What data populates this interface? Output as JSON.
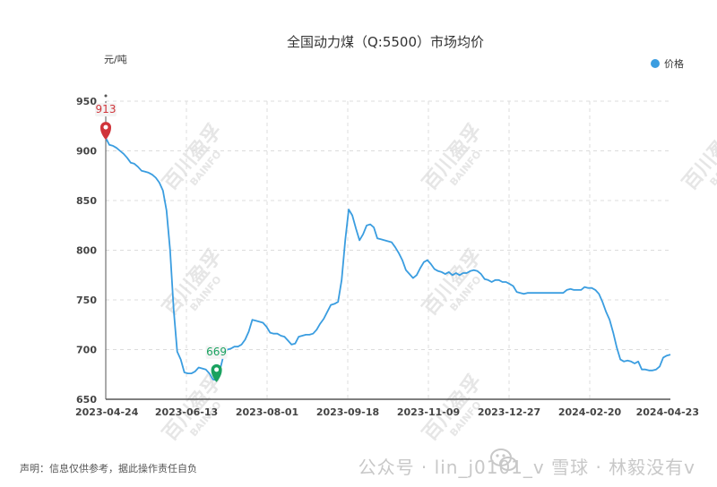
{
  "chart_data": {
    "type": "line",
    "title": "全国动力煤（Q:5500）市场均价",
    "ylabel": "元/吨",
    "ylim": [
      650,
      950
    ],
    "yticks": [
      650,
      700,
      750,
      800,
      850,
      900,
      950
    ],
    "xtick_labels": [
      "2023-04-24",
      "2023-06-13",
      "2023-08-01",
      "2023-09-18",
      "2023-11-09",
      "2023-12-27",
      "2024-02-20",
      "2024-04-23"
    ],
    "grid": true,
    "legend_position": "top-right",
    "series": [
      {
        "name": "价格",
        "color": "#3a9de0",
        "values": [
          913,
          906,
          905,
          903,
          900,
          897,
          893,
          888,
          887,
          884,
          880,
          879,
          878,
          876,
          873,
          868,
          860,
          840,
          800,
          740,
          698,
          690,
          677,
          676,
          676,
          678,
          682,
          681,
          680,
          676,
          670,
          669,
          680,
          695,
          700,
          701,
          703,
          703,
          705,
          710,
          718,
          730,
          729,
          728,
          727,
          723,
          717,
          716,
          716,
          714,
          713,
          709,
          705,
          706,
          713,
          714,
          715,
          715,
          716,
          720,
          726,
          731,
          738,
          745,
          746,
          748,
          770,
          810,
          841,
          835,
          822,
          810,
          816,
          825,
          826,
          823,
          812,
          811,
          810,
          809,
          808,
          803,
          797,
          790,
          780,
          776,
          772,
          775,
          782,
          788,
          790,
          786,
          781,
          779,
          778,
          776,
          778,
          775,
          777,
          775,
          777,
          777,
          779,
          780,
          779,
          776,
          771,
          770,
          768,
          770,
          770,
          768,
          768,
          766,
          764,
          758,
          757,
          756,
          757,
          757,
          757,
          757,
          757,
          757,
          757,
          757,
          757,
          757,
          757,
          760,
          761,
          760,
          760,
          760,
          763,
          762,
          762,
          760,
          756,
          748,
          738,
          730,
          717,
          702,
          690,
          688,
          689,
          688,
          686,
          688,
          680,
          680,
          679,
          679,
          680,
          683,
          692,
          694,
          695
        ]
      }
    ],
    "annotations": [
      {
        "type": "max",
        "label": "913",
        "value": 913,
        "color": "#d0343a"
      },
      {
        "type": "min",
        "label": "669",
        "value": 669,
        "color": "#1aa260"
      }
    ]
  },
  "watermark": {
    "brand": "百川盈孚",
    "sub": "BAINFO",
    "footer": "公众号 · lin_j0101_v  雪球 · 林毅没有v"
  },
  "disclaimer": "声明：信息仅供参考，据此操作责任自负",
  "icons": {
    "wechat": "wechat-icon"
  }
}
